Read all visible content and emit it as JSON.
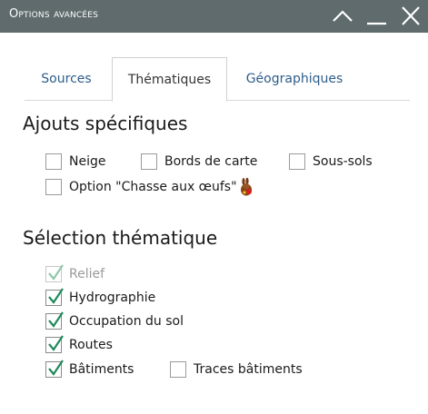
{
  "window": {
    "title": "Options avancées",
    "controls": [
      "collapse-icon",
      "minimize-icon",
      "close-icon"
    ]
  },
  "tabs": [
    {
      "label": "Sources",
      "active": false
    },
    {
      "label": "Thématiques",
      "active": true
    },
    {
      "label": "Géographiques",
      "active": false
    }
  ],
  "ajouts": {
    "title": "Ajouts spécifiques",
    "items": [
      {
        "label": "Neige",
        "checked": false
      },
      {
        "label": "Bords de carte",
        "checked": false
      },
      {
        "label": "Sous-sols",
        "checked": false
      },
      {
        "label": "Option \"Chasse aux œufs\"",
        "checked": false,
        "icon": "chocolate-bunny-icon"
      }
    ]
  },
  "selection": {
    "title": "Sélection thématique",
    "items": [
      {
        "label": "Relief",
        "checked": true,
        "disabled": true
      },
      {
        "label": "Hydrographie",
        "checked": true
      },
      {
        "label": "Occupation du sol",
        "checked": true
      },
      {
        "label": "Routes",
        "checked": true
      },
      {
        "label": "Bâtiments",
        "checked": true
      },
      {
        "label": "Traces bâtiments",
        "checked": false
      }
    ]
  },
  "colors": {
    "titlebar": "#5f6b6d",
    "tab_link": "#2e5d8a",
    "check": "#1f8a5c"
  }
}
